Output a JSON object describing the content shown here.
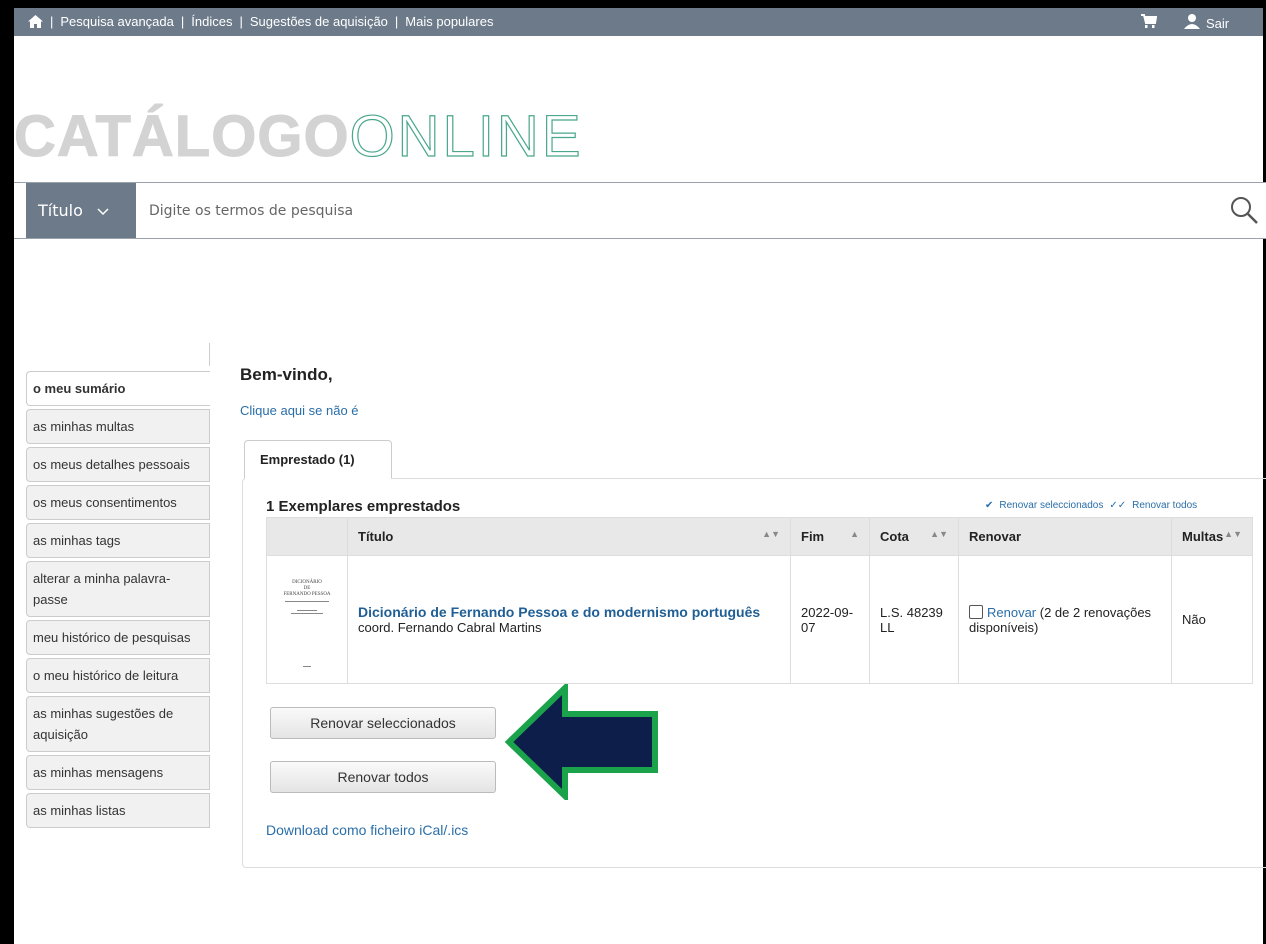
{
  "topbar": {
    "nav": [
      "Pesquisa avançada",
      "Índices",
      "Sugestões de aquisição",
      "Mais populares"
    ],
    "logout_label": "Sair",
    "icons": [
      "home-icon",
      "cart-icon",
      "user-icon"
    ]
  },
  "logo": {
    "bold": "CATÁLOGO",
    "thin": "ONLINE"
  },
  "search": {
    "index_label": "Título",
    "placeholder": "Digite os termos de pesquisa"
  },
  "sidebar": {
    "items": [
      "o meu sumário",
      "as minhas multas",
      "os meus detalhes pessoais",
      "os meus consentimentos",
      "as minhas tags",
      "alterar a minha palavra-passe",
      "meu histórico de pesquisas",
      "o meu histórico de leitura",
      "as minhas sugestões de aquisição",
      "as minhas mensagens",
      "as minhas listas"
    ],
    "active_index": 0
  },
  "main": {
    "welcome": "Bem-vindo,",
    "not_you_link": "Clique aqui se não é",
    "tab_label": "Emprestado (1)",
    "items_heading": "1 Exemplares emprestados",
    "renew_selected_link": "Renovar seleccionados",
    "renew_all_link": "Renovar todos",
    "columns": [
      "Título",
      "Fim",
      "Cota",
      "Renovar",
      "Multas"
    ],
    "loans": [
      {
        "cover_text": [
          "DICIONÁRIO",
          "DE",
          "FERNANDO PESSOA"
        ],
        "title": "Dicionário de Fernando Pessoa e do modernismo português",
        "author": "coord. Fernando Cabral Martins",
        "due": "2022-09-07",
        "call_number": "L.S. 48239 LL",
        "renew_link": "Renovar",
        "renew_info": "(2 de 2 renovações disponíveis)",
        "fines": "Não"
      }
    ],
    "btn_renew_selected": "Renovar seleccionados",
    "btn_renew_all": "Renovar todos",
    "download_link": "Download como ficheiro iCal/.ics"
  },
  "colors": {
    "topbar": "#6c7a8a",
    "link": "#2a6ea8",
    "arrow_fill": "#0d1e4a",
    "arrow_border": "#1aa34a"
  }
}
